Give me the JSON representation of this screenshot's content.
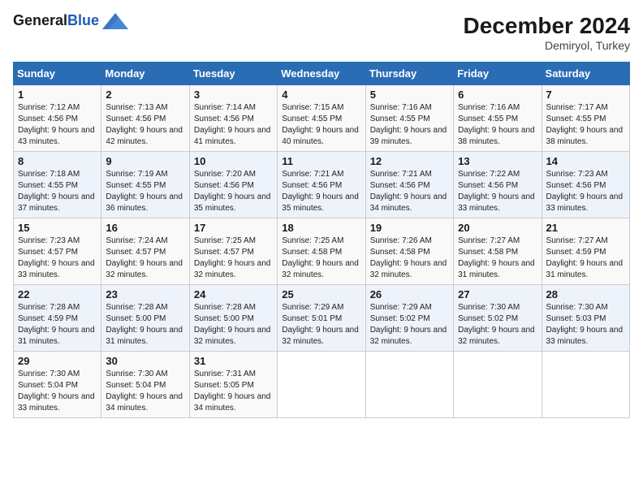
{
  "header": {
    "logo_general": "General",
    "logo_blue": "Blue",
    "month_title": "December 2024",
    "location": "Demiryol, Turkey"
  },
  "calendar": {
    "days_of_week": [
      "Sunday",
      "Monday",
      "Tuesday",
      "Wednesday",
      "Thursday",
      "Friday",
      "Saturday"
    ],
    "weeks": [
      [
        {
          "day": "",
          "sunrise": "",
          "sunset": "",
          "daylight": ""
        },
        {
          "day": "",
          "sunrise": "",
          "sunset": "",
          "daylight": ""
        },
        {
          "day": "",
          "sunrise": "",
          "sunset": "",
          "daylight": ""
        },
        {
          "day": "",
          "sunrise": "",
          "sunset": "",
          "daylight": ""
        },
        {
          "day": "",
          "sunrise": "",
          "sunset": "",
          "daylight": ""
        },
        {
          "day": "",
          "sunrise": "",
          "sunset": "",
          "daylight": ""
        },
        {
          "day": "",
          "sunrise": "",
          "sunset": "",
          "daylight": ""
        }
      ],
      [
        {
          "day": "1",
          "sunrise": "Sunrise: 7:12 AM",
          "sunset": "Sunset: 4:56 PM",
          "daylight": "Daylight: 9 hours and 43 minutes."
        },
        {
          "day": "2",
          "sunrise": "Sunrise: 7:13 AM",
          "sunset": "Sunset: 4:56 PM",
          "daylight": "Daylight: 9 hours and 42 minutes."
        },
        {
          "day": "3",
          "sunrise": "Sunrise: 7:14 AM",
          "sunset": "Sunset: 4:56 PM",
          "daylight": "Daylight: 9 hours and 41 minutes."
        },
        {
          "day": "4",
          "sunrise": "Sunrise: 7:15 AM",
          "sunset": "Sunset: 4:55 PM",
          "daylight": "Daylight: 9 hours and 40 minutes."
        },
        {
          "day": "5",
          "sunrise": "Sunrise: 7:16 AM",
          "sunset": "Sunset: 4:55 PM",
          "daylight": "Daylight: 9 hours and 39 minutes."
        },
        {
          "day": "6",
          "sunrise": "Sunrise: 7:16 AM",
          "sunset": "Sunset: 4:55 PM",
          "daylight": "Daylight: 9 hours and 38 minutes."
        },
        {
          "day": "7",
          "sunrise": "Sunrise: 7:17 AM",
          "sunset": "Sunset: 4:55 PM",
          "daylight": "Daylight: 9 hours and 38 minutes."
        }
      ],
      [
        {
          "day": "8",
          "sunrise": "Sunrise: 7:18 AM",
          "sunset": "Sunset: 4:55 PM",
          "daylight": "Daylight: 9 hours and 37 minutes."
        },
        {
          "day": "9",
          "sunrise": "Sunrise: 7:19 AM",
          "sunset": "Sunset: 4:55 PM",
          "daylight": "Daylight: 9 hours and 36 minutes."
        },
        {
          "day": "10",
          "sunrise": "Sunrise: 7:20 AM",
          "sunset": "Sunset: 4:56 PM",
          "daylight": "Daylight: 9 hours and 35 minutes."
        },
        {
          "day": "11",
          "sunrise": "Sunrise: 7:21 AM",
          "sunset": "Sunset: 4:56 PM",
          "daylight": "Daylight: 9 hours and 35 minutes."
        },
        {
          "day": "12",
          "sunrise": "Sunrise: 7:21 AM",
          "sunset": "Sunset: 4:56 PM",
          "daylight": "Daylight: 9 hours and 34 minutes."
        },
        {
          "day": "13",
          "sunrise": "Sunrise: 7:22 AM",
          "sunset": "Sunset: 4:56 PM",
          "daylight": "Daylight: 9 hours and 33 minutes."
        },
        {
          "day": "14",
          "sunrise": "Sunrise: 7:23 AM",
          "sunset": "Sunset: 4:56 PM",
          "daylight": "Daylight: 9 hours and 33 minutes."
        }
      ],
      [
        {
          "day": "15",
          "sunrise": "Sunrise: 7:23 AM",
          "sunset": "Sunset: 4:57 PM",
          "daylight": "Daylight: 9 hours and 33 minutes."
        },
        {
          "day": "16",
          "sunrise": "Sunrise: 7:24 AM",
          "sunset": "Sunset: 4:57 PM",
          "daylight": "Daylight: 9 hours and 32 minutes."
        },
        {
          "day": "17",
          "sunrise": "Sunrise: 7:25 AM",
          "sunset": "Sunset: 4:57 PM",
          "daylight": "Daylight: 9 hours and 32 minutes."
        },
        {
          "day": "18",
          "sunrise": "Sunrise: 7:25 AM",
          "sunset": "Sunset: 4:58 PM",
          "daylight": "Daylight: 9 hours and 32 minutes."
        },
        {
          "day": "19",
          "sunrise": "Sunrise: 7:26 AM",
          "sunset": "Sunset: 4:58 PM",
          "daylight": "Daylight: 9 hours and 32 minutes."
        },
        {
          "day": "20",
          "sunrise": "Sunrise: 7:27 AM",
          "sunset": "Sunset: 4:58 PM",
          "daylight": "Daylight: 9 hours and 31 minutes."
        },
        {
          "day": "21",
          "sunrise": "Sunrise: 7:27 AM",
          "sunset": "Sunset: 4:59 PM",
          "daylight": "Daylight: 9 hours and 31 minutes."
        }
      ],
      [
        {
          "day": "22",
          "sunrise": "Sunrise: 7:28 AM",
          "sunset": "Sunset: 4:59 PM",
          "daylight": "Daylight: 9 hours and 31 minutes."
        },
        {
          "day": "23",
          "sunrise": "Sunrise: 7:28 AM",
          "sunset": "Sunset: 5:00 PM",
          "daylight": "Daylight: 9 hours and 31 minutes."
        },
        {
          "day": "24",
          "sunrise": "Sunrise: 7:28 AM",
          "sunset": "Sunset: 5:00 PM",
          "daylight": "Daylight: 9 hours and 32 minutes."
        },
        {
          "day": "25",
          "sunrise": "Sunrise: 7:29 AM",
          "sunset": "Sunset: 5:01 PM",
          "daylight": "Daylight: 9 hours and 32 minutes."
        },
        {
          "day": "26",
          "sunrise": "Sunrise: 7:29 AM",
          "sunset": "Sunset: 5:02 PM",
          "daylight": "Daylight: 9 hours and 32 minutes."
        },
        {
          "day": "27",
          "sunrise": "Sunrise: 7:30 AM",
          "sunset": "Sunset: 5:02 PM",
          "daylight": "Daylight: 9 hours and 32 minutes."
        },
        {
          "day": "28",
          "sunrise": "Sunrise: 7:30 AM",
          "sunset": "Sunset: 5:03 PM",
          "daylight": "Daylight: 9 hours and 33 minutes."
        }
      ],
      [
        {
          "day": "29",
          "sunrise": "Sunrise: 7:30 AM",
          "sunset": "Sunset: 5:04 PM",
          "daylight": "Daylight: 9 hours and 33 minutes."
        },
        {
          "day": "30",
          "sunrise": "Sunrise: 7:30 AM",
          "sunset": "Sunset: 5:04 PM",
          "daylight": "Daylight: 9 hours and 34 minutes."
        },
        {
          "day": "31",
          "sunrise": "Sunrise: 7:31 AM",
          "sunset": "Sunset: 5:05 PM",
          "daylight": "Daylight: 9 hours and 34 minutes."
        },
        {
          "day": "",
          "sunrise": "",
          "sunset": "",
          "daylight": ""
        },
        {
          "day": "",
          "sunrise": "",
          "sunset": "",
          "daylight": ""
        },
        {
          "day": "",
          "sunrise": "",
          "sunset": "",
          "daylight": ""
        },
        {
          "day": "",
          "sunrise": "",
          "sunset": "",
          "daylight": ""
        }
      ]
    ]
  }
}
